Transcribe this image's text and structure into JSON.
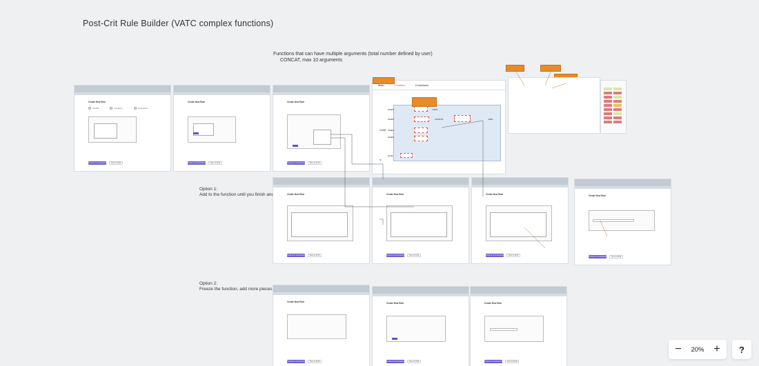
{
  "board": {
    "title": "Post-Crit Rule Builder (VATC complex functions)"
  },
  "notes": {
    "functions_line1": "Functions that can have multiple arguments (total number defined by user)",
    "functions_line2": "CONCAT, max 10 arguments",
    "option1_line1": "Option 1:",
    "option1_line2": "Add to the function until you finish and freeze it",
    "option2_line1": "Option 2:",
    "option2_line2": "Freeze the function, add more pieces step by step"
  },
  "frames": {
    "title": "Create New Rule",
    "steps": [
      "General",
      "Conditions",
      "Conclusions",
      "Review"
    ],
    "subtitle": "Set the conditions rule can trigger upon true.",
    "section": "Conditions",
    "primary_btn": "Continue to Conclusions",
    "secondary_btn": "Save as Draft",
    "cancel_btn": "Cancel",
    "add_btn": "+ Add condition"
  },
  "big_mock": {
    "tabs": [
      "Main",
      "Condition",
      "Conclusion"
    ],
    "case_labels": [
      "WHEN",
      "WHEN",
      "WHEN",
      "WHEN",
      "ELSE"
    ],
    "then_label": "THEN",
    "concat_label": "CONCAT",
    "case_word": "CASE",
    "end_word": "END",
    "if_word": "IF"
  },
  "zoom": {
    "minus": "−",
    "value": "20%",
    "plus": "+",
    "help": "?"
  },
  "colors": {
    "accent": "#6b5fd3",
    "annotation": "#e98b2a",
    "canvas": "#eef0f2"
  }
}
